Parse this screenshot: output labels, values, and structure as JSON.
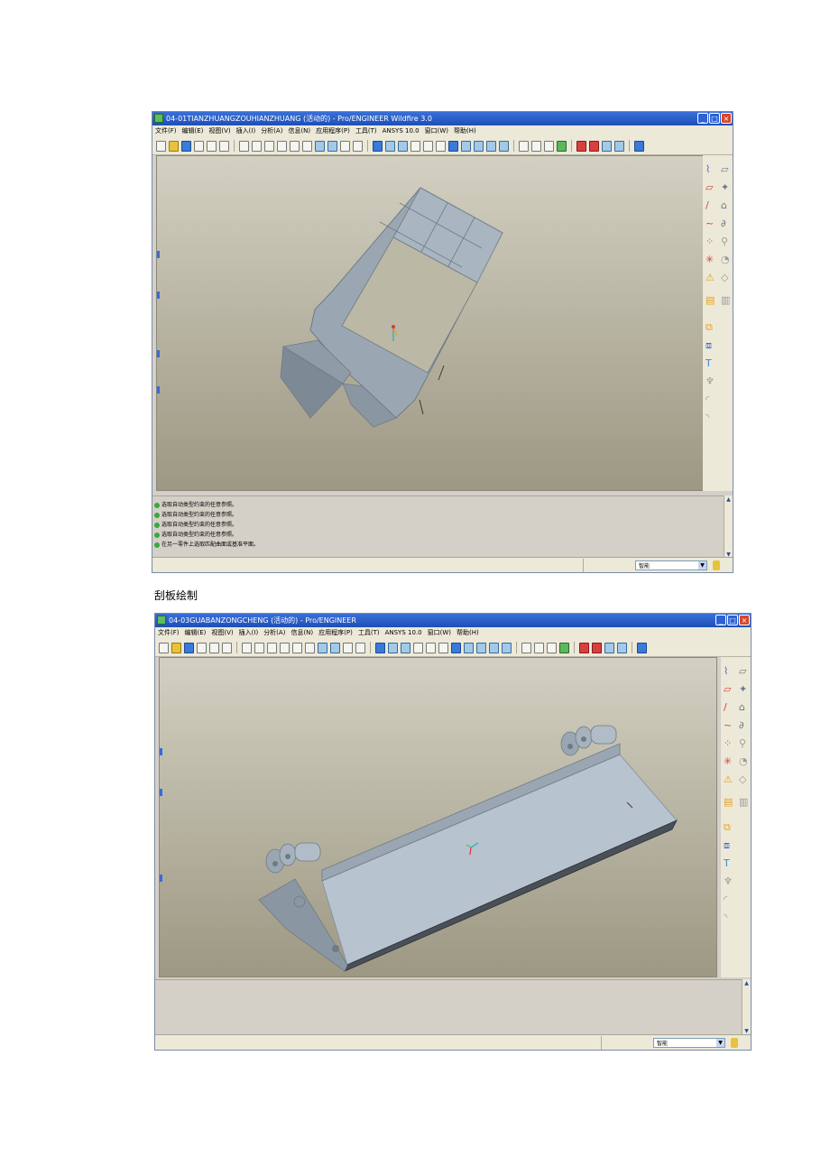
{
  "screenshot1": {
    "title": "04-01TIANZHUANGZOUHIANZHUANG (活动的) - Pro/ENGINEER Wildfire 3.0",
    "menu": [
      "文件(F)",
      "编辑(E)",
      "视图(V)",
      "插入(I)",
      "分析(A)",
      "信息(N)",
      "应用程序(P)",
      "工具(T)",
      "ANSYS 10.0",
      "窗口(W)",
      "帮助(H)"
    ],
    "messages": [
      "选取自动类型约束的任意参照。",
      "选取自动类型约束的任意参照。",
      "选取自动类型约束的任意参照。",
      "选取自动类型约束的任意参照。",
      "在另一零件上选取匹配曲面或基准平面。"
    ],
    "filter_value": "智能"
  },
  "caption": "刮板绘制",
  "screenshot2": {
    "title": "04-03GUABANZONGCHENG (活动的) - Pro/ENGINEER",
    "menu": [
      "文件(F)",
      "编辑(E)",
      "视图(V)",
      "插入(I)",
      "分析(A)",
      "信息(N)",
      "应用程序(P)",
      "工具(T)",
      "ANSYS 10.0",
      "窗口(W)",
      "帮助(H)"
    ],
    "filter_value": "智能"
  },
  "colors": {
    "titlebar": "#2458c8",
    "viewport_top": "#d3d0c2",
    "viewport_bottom": "#9d9883",
    "model_fill": "#9aa7b3",
    "model_light": "#b7c3cf"
  },
  "icons": [
    "app-icon",
    "minimize-icon",
    "maximize-icon",
    "close-icon",
    "new-file-icon",
    "open-icon",
    "save-icon",
    "print-icon",
    "undo-icon",
    "redo-icon",
    "zoom-in-icon",
    "zoom-out-icon",
    "refit-icon",
    "datum-plane-icon",
    "datum-axis-icon",
    "sketch-icon",
    "extrude-icon",
    "revolve-icon",
    "hole-icon",
    "round-icon",
    "chamfer-icon",
    "help-icon"
  ]
}
